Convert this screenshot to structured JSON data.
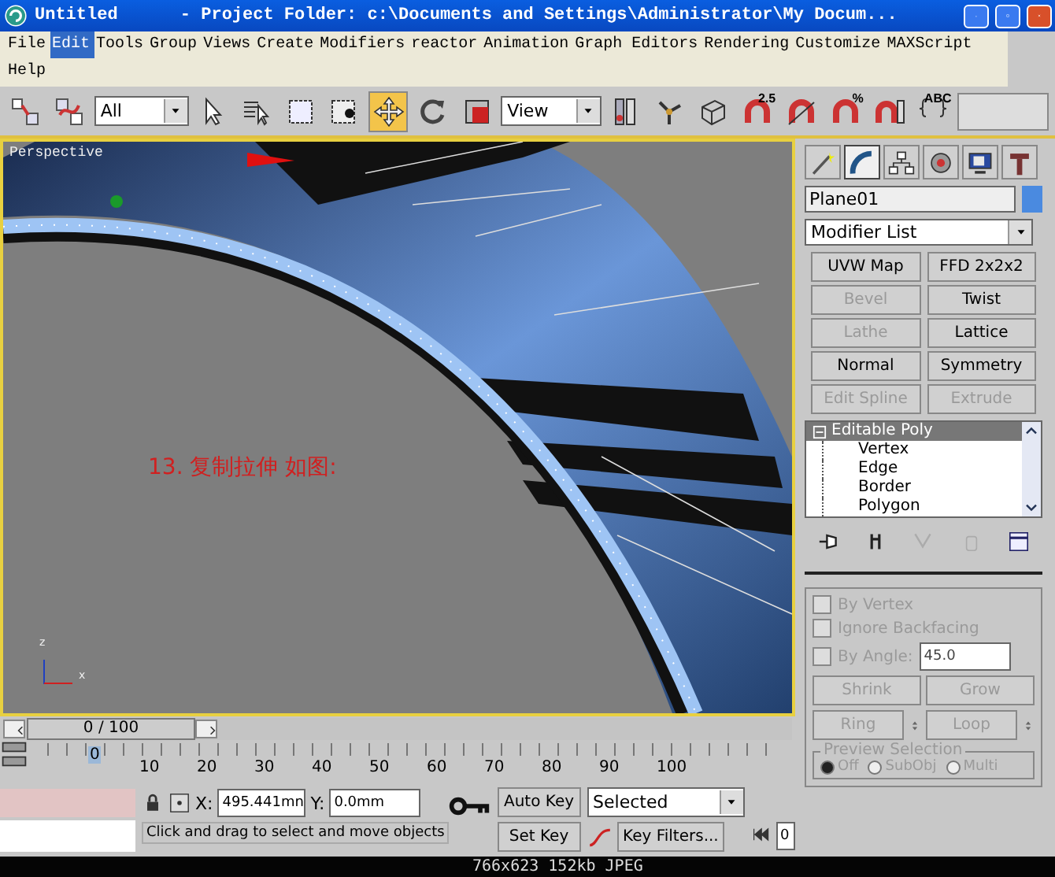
{
  "window": {
    "title": "Untitled      - Project Folder: c:\\Documents and Settings\\Administrator\\My Docum..."
  },
  "menu": [
    {
      "label": "File",
      "selected": false
    },
    {
      "label": "Edit",
      "selected": true
    },
    {
      "label": "Tools",
      "selected": false
    },
    {
      "label": "Group",
      "selected": false
    },
    {
      "label": "Views",
      "selected": false
    },
    {
      "label": "Create",
      "selected": false
    },
    {
      "label": "Modifiers",
      "selected": false
    },
    {
      "label": "reactor",
      "selected": false
    },
    {
      "label": "Animation",
      "selected": false
    },
    {
      "label": "Graph Editors",
      "selected": false
    },
    {
      "label": "Rendering",
      "selected": false
    },
    {
      "label": "Customize",
      "selected": false
    },
    {
      "label": "MAXScript",
      "selected": false
    },
    {
      "label": "Help",
      "selected": false
    }
  ],
  "toolbar": [
    {
      "kind": "button",
      "selected": false
    },
    {
      "kind": "button",
      "selected": false
    },
    {
      "kind": "dropdown",
      "value": "All"
    },
    {
      "kind": "button",
      "selected": false
    },
    {
      "kind": "button",
      "selected": false
    },
    {
      "kind": "button",
      "selected": false
    },
    {
      "kind": "button",
      "selected": false
    },
    {
      "kind": "button",
      "selected": true
    },
    {
      "kind": "button",
      "selected": false
    },
    {
      "kind": "button",
      "selected": false
    },
    {
      "kind": "dropdown",
      "value": "View"
    },
    {
      "kind": "button",
      "selected": false
    },
    {
      "kind": "button",
      "selected": false
    },
    {
      "kind": "button",
      "selected": false
    },
    {
      "kind": "button",
      "selected": false,
      "label": "2.5"
    },
    {
      "kind": "button",
      "selected": false
    },
    {
      "kind": "button",
      "selected": false,
      "label": "%"
    },
    {
      "kind": "button",
      "selected": false
    },
    {
      "kind": "button",
      "selected": false,
      "label": "ABC"
    },
    {
      "kind": "field"
    }
  ],
  "viewport": {
    "label": "Perspective",
    "caption": "13. 复制拉伸 如图:",
    "axis": [
      "z",
      "x"
    ]
  },
  "command_panel": {
    "tabs": [
      {
        "selected": false
      },
      {
        "selected": true
      },
      {
        "selected": false
      },
      {
        "selected": false
      },
      {
        "selected": false
      },
      {
        "selected": false
      }
    ],
    "object_name": "Plane01",
    "modifier_list": "Modifier List",
    "modifier_buttons": [
      {
        "label": "UVW Map",
        "disabled": false
      },
      {
        "label": "FFD 2x2x2",
        "disabled": false
      },
      {
        "label": "Bevel",
        "disabled": true
      },
      {
        "label": "Twist",
        "disabled": false
      },
      {
        "label": "Lathe",
        "disabled": true
      },
      {
        "label": "Lattice",
        "disabled": false
      },
      {
        "label": "Normal",
        "disabled": false
      },
      {
        "label": "Symmetry",
        "disabled": false
      },
      {
        "label": "Edit Spline",
        "disabled": true
      },
      {
        "label": "Extrude",
        "disabled": true
      }
    ],
    "stack": [
      {
        "label": "Editable Poly",
        "selected": true,
        "expanded": true,
        "children": [
          {
            "label": "Vertex",
            "selected": false
          },
          {
            "label": "Edge",
            "selected": false
          },
          {
            "label": "Border",
            "selected": false
          },
          {
            "label": "Polygon",
            "selected": false
          }
        ]
      }
    ],
    "stack_tools": [
      {
        "disabled": false
      },
      {
        "disabled": false
      },
      {
        "disabled": true
      },
      {
        "disabled": true
      },
      {
        "disabled": false
      }
    ],
    "rollout": {
      "disabled": true,
      "checkboxes": [
        {
          "label": "By Vertex",
          "checked": false
        },
        {
          "label": "Ignore Backfacing",
          "checked": false
        },
        {
          "label": "By Angle:",
          "checked": false,
          "value": "45.0"
        }
      ],
      "buttons": [
        {
          "label": "Shrink",
          "kind": "button"
        },
        {
          "label": "Grow",
          "kind": "button"
        },
        {
          "label": "Ring",
          "kind": "spinner"
        },
        {
          "label": "Loop",
          "kind": "spinner"
        }
      ],
      "preview_selection": {
        "title": "Preview Selection",
        "options": [
          {
            "label": "Off",
            "selected": true
          },
          {
            "label": "SubObj",
            "selected": false
          },
          {
            "label": "Multi",
            "selected": false
          }
        ]
      }
    }
  },
  "time_slider": {
    "label": "0 / 100",
    "level": 0
  },
  "ruler": {
    "ticks": [
      {
        "label": "0",
        "selected": true
      },
      {
        "label": "10",
        "selected": false
      },
      {
        "label": "20",
        "selected": false
      },
      {
        "label": "30",
        "selected": false
      },
      {
        "label": "40",
        "selected": false
      },
      {
        "label": "50",
        "selected": false
      },
      {
        "label": "60",
        "selected": false
      },
      {
        "label": "70",
        "selected": false
      },
      {
        "label": "80",
        "selected": false
      },
      {
        "label": "90",
        "selected": false
      },
      {
        "label": "100",
        "selected": false
      }
    ]
  },
  "status_bar": {
    "x": "495.441mn",
    "y": "0.0mm",
    "x_label": "X:",
    "y_label": "Y:",
    "prompt": "Click and drag to select and move objects",
    "auto_key": "Auto Key",
    "set_key": "Set Key",
    "key_mode": "Selected",
    "key_filters": "Key Filters...",
    "frame": "0"
  },
  "caption": "766x623 152kb JPEG"
}
